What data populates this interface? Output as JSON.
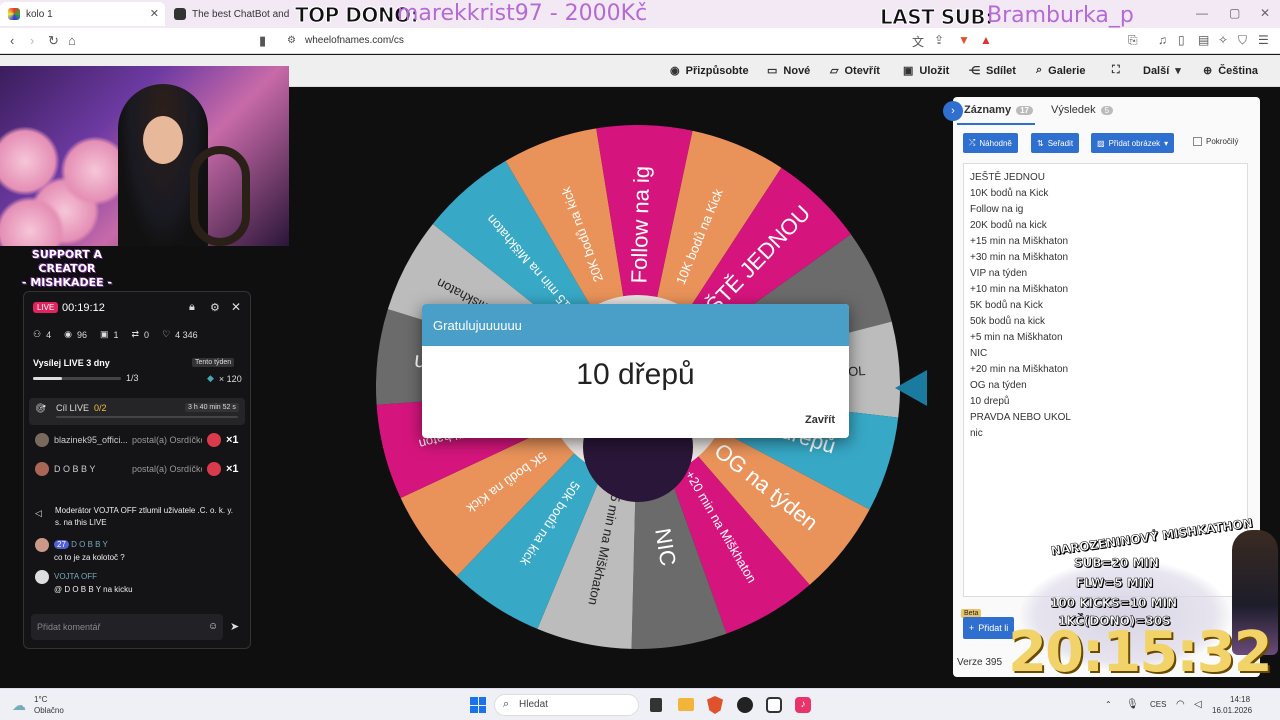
{
  "browser": {
    "tabs": [
      {
        "title": "kolo 1",
        "active": true
      },
      {
        "title": "The best ChatBot and Widgets",
        "active": false
      }
    ],
    "url": "wheelofnames.com/cs"
  },
  "overlay": {
    "top_dono_label": "TOP DONO:",
    "top_dono_value": "marekkrist97 - 2000Kč",
    "last_sub_label": "LAST SUB:",
    "last_sub_value": "Bramburka_p"
  },
  "site_header": {
    "items": [
      "Přizpůsobte",
      "Nové",
      "Otevřít",
      "Uložit",
      "Sdílet",
      "Galerie",
      "Další",
      "Čeština"
    ]
  },
  "webcam": {
    "caption_line1": "SUPPORT A CREATOR",
    "caption_line2": "- MISHKADEE -"
  },
  "live_panel": {
    "badge": "LIVE",
    "timer": "00:19:12",
    "stats": {
      "viewers_total": "4",
      "views": "96",
      "gifts": "1",
      "shares": "0",
      "likes": "4 346"
    },
    "goal_title": "Vysílej LIVE 3 dny",
    "goal_tag": "Tento týden",
    "goal_progress_text": "1/3",
    "goal_progress": 0.33,
    "goal_reward": "× 120",
    "cil_label": "Cíl LIVE",
    "cil_value": "0/2",
    "cil_timer": "3 h 40 min 52 s",
    "gifts": [
      {
        "user": "blazinek95_offici...",
        "text": "postal(a) Osrdíčko",
        "count": "×1"
      },
      {
        "user": "D O B B Y",
        "text": "postal(a) Osrdíčko",
        "count": "×1"
      }
    ],
    "system_message": "Moderátor VOJTA OFF ztlumil uživatele .C. o. k. y. s. na this LIVE",
    "chat": [
      {
        "badge": "27",
        "user": "D O B B Y",
        "text": "co to je za kolotoč ?"
      },
      {
        "badge": "",
        "user": "VOJTA OFF",
        "text": "@ D O B B Y na kicku"
      }
    ],
    "comment_placeholder": "Přidat komentář"
  },
  "wheel": {
    "segments": [
      "10K bodů na Kick",
      "JEŠTĚ JEDNOU",
      "nic",
      "PRAVDA NEBO UKOL",
      "10 drepů",
      "OG na týden",
      "+20 min na Miškhaton",
      "NIC",
      "+5 min na Miškhaton",
      "50k bodů na kick",
      "5K bodů na Kick",
      "+10 min na Miškhaton",
      "VIP na týden",
      "+30 min na Miškhaton",
      "+15 min na Miškhaton",
      "20K bodů na kick",
      "Follow na ig"
    ],
    "colors": [
      "#e9935a",
      "#d5157d",
      "#6b6b6b",
      "#bcbcbc",
      "#37a8c6"
    ]
  },
  "dialog": {
    "title": "Gratulujuuuuuu",
    "result": "10 dřepů",
    "close": "Zavřít"
  },
  "right_panel": {
    "tab_entries": "Záznamy",
    "tab_entries_count": "17",
    "tab_results": "Výsledek",
    "tab_results_count": "5",
    "btn_shuffle": "Náhodně",
    "btn_sort": "Seřadit",
    "btn_add_image": "Přidat obrázek",
    "advanced": "Pokročilý",
    "entries": [
      "JEŠTĚ JEDNOU",
      "10K bodů na Kick",
      "Follow na ig",
      "20K bodů na kick",
      "+15 min na Miškhaton",
      "+30 min na Miškhaton",
      "VIP na týden",
      "+10 min na Miškhaton",
      "5K bodů na Kick",
      "50k bodů na kick",
      "+5 min na Miškhaton",
      "NIC",
      "+20 min na Miškhaton",
      "OG na týden",
      "10 drepů",
      "PRAVDA NEBO UKOL",
      "nic"
    ],
    "beta": "Beta",
    "add_btn": "Přidat li",
    "version": "Verze 395"
  },
  "mishkathon": {
    "title": "NAROZENINOVÝ MISHKATHON",
    "rules": [
      "SUB=20 MIN",
      "FLW=5 MIN",
      "100 KICKS=10 MIN",
      "1KČ(DONO)=30S"
    ],
    "clock": "20:15:32"
  },
  "taskbar": {
    "weather_temp": "1°C",
    "weather_desc": "Oblačno",
    "search": "Hledat",
    "lang": "CES",
    "time": "14:18",
    "date": "16.01.2026"
  }
}
